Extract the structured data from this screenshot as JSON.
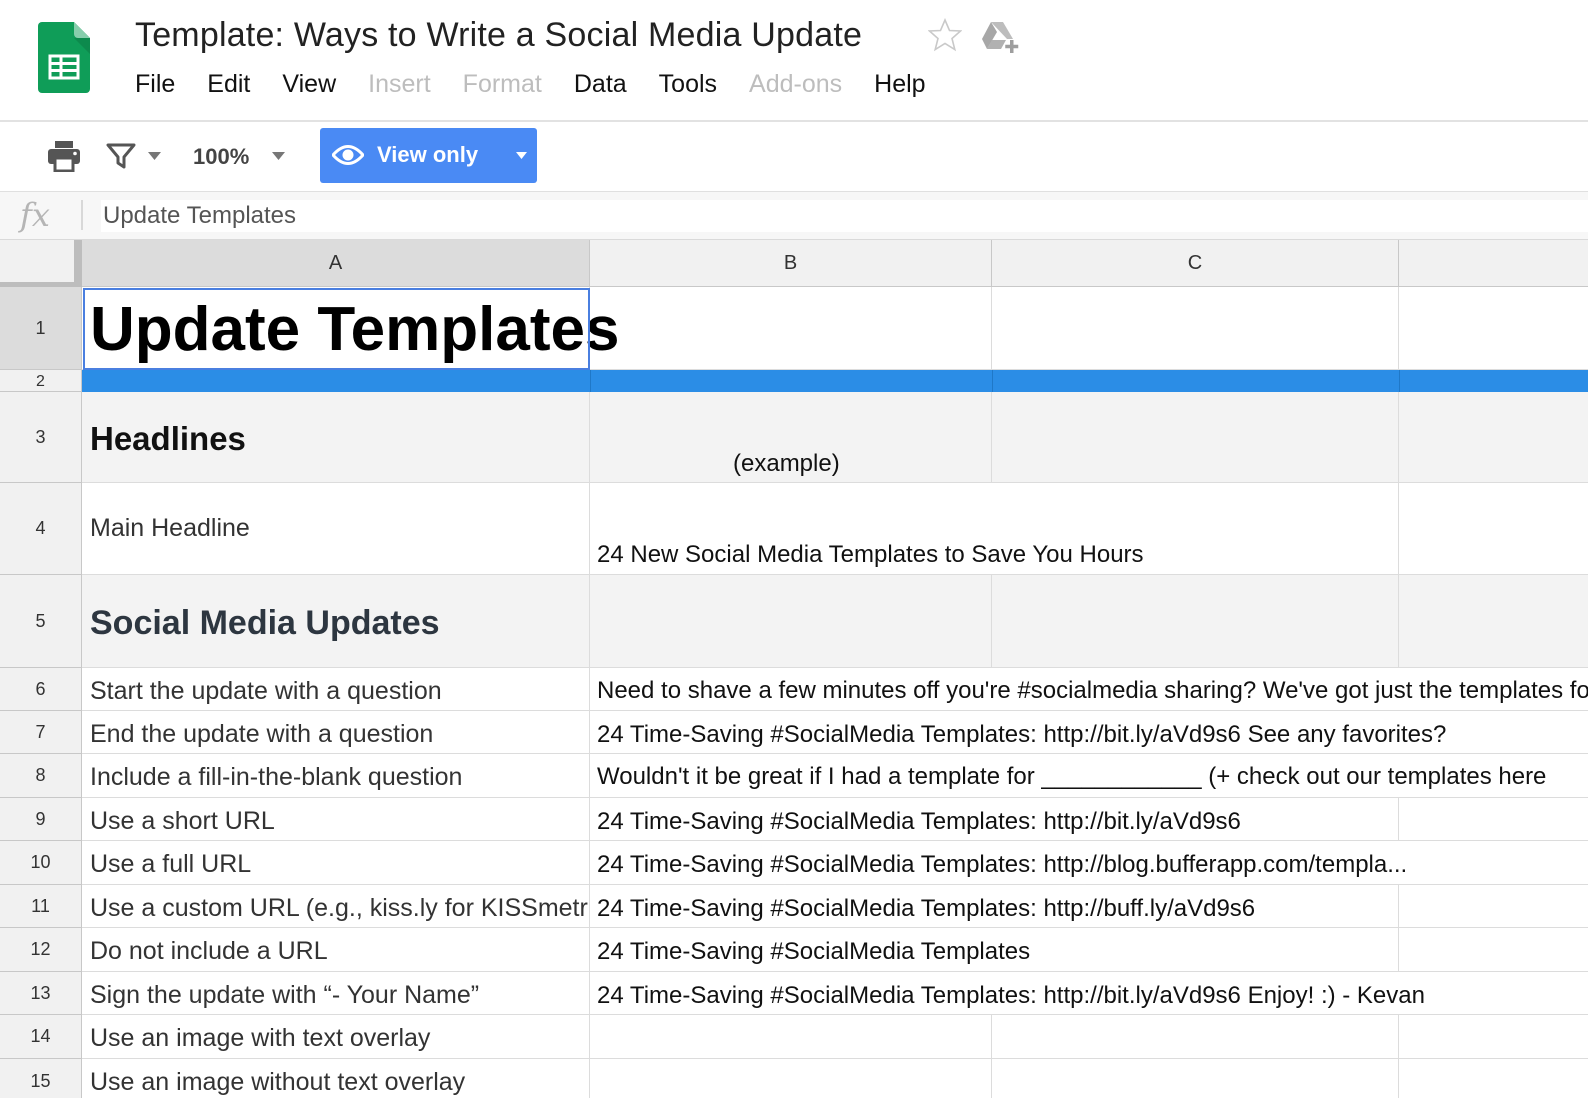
{
  "doc": {
    "title": "Template: Ways to Write a Social Media Update",
    "icons": {
      "logo": "google-sheets-logo-icon",
      "star": "star-icon",
      "drive": "add-to-drive-icon"
    }
  },
  "menu": [
    {
      "label": "File",
      "enabled": true
    },
    {
      "label": "Edit",
      "enabled": true
    },
    {
      "label": "View",
      "enabled": true
    },
    {
      "label": "Insert",
      "enabled": false
    },
    {
      "label": "Format",
      "enabled": false
    },
    {
      "label": "Data",
      "enabled": true
    },
    {
      "label": "Tools",
      "enabled": true
    },
    {
      "label": "Add-ons",
      "enabled": false
    },
    {
      "label": "Help",
      "enabled": true
    }
  ],
  "toolbar": {
    "zoom": "100%",
    "view_only_label": "View only",
    "icons": [
      "print-icon",
      "filter-icon",
      "eye-icon",
      "dropdown-arrow-icon"
    ]
  },
  "formula_bar": {
    "fx_label": "fx",
    "value": "Update Templates"
  },
  "columns": [
    "A",
    "B",
    "C"
  ],
  "rows": {
    "r1": {
      "num": "1",
      "a": "Update Templates"
    },
    "r2": {
      "num": "2"
    },
    "r3": {
      "num": "3",
      "a": "Headlines",
      "b": "(example)"
    },
    "r4": {
      "num": "4",
      "a": "Main Headline",
      "b": "24 New Social Media Templates to Save You Hours"
    },
    "r5": {
      "num": "5",
      "a": "Social Media Updates"
    },
    "r6": {
      "num": "6",
      "a": "Start the update with a question",
      "b": "Need to shave a few minutes off you're #socialmedia sharing? We've got just the templates for you"
    },
    "r7": {
      "num": "7",
      "a": "End the update with a question",
      "b": "24 Time-Saving #SocialMedia Templates: http://bit.ly/aVd9s6 See any favorites?"
    },
    "r8": {
      "num": "8",
      "a": "Include a fill-in-the-blank question",
      "b": "Wouldn't it be great if I had a template for ____________ (+ check out our templates here"
    },
    "r9": {
      "num": "9",
      "a": "Use a short URL",
      "b": "24 Time-Saving #SocialMedia Templates: http://bit.ly/aVd9s6"
    },
    "r10": {
      "num": "10",
      "a": "Use a full URL",
      "b": "24 Time-Saving #SocialMedia Templates: http://blog.bufferapp.com/templa..."
    },
    "r11": {
      "num": "11",
      "a": "Use a custom URL (e.g., kiss.ly for KISSmetrics)",
      "b": "24 Time-Saving #SocialMedia Templates: http://buff.ly/aVd9s6"
    },
    "r12": {
      "num": "12",
      "a": "Do not include a URL",
      "b": "24 Time-Saving #SocialMedia Templates"
    },
    "r13": {
      "num": "13",
      "a": "Sign the update with “- Your Name”",
      "b": "24 Time-Saving #SocialMedia Templates: http://bit.ly/aVd9s6 Enjoy! :) - Kevan"
    },
    "r14": {
      "num": "14",
      "a": "Use an image with text overlay"
    },
    "r15": {
      "num": "15",
      "a": "Use an image without text overlay"
    }
  },
  "colors": {
    "accent": "#4a8af4",
    "band": "#2b8de6",
    "sheets_green": "#0f9d58",
    "selection": "#4a7fe0"
  }
}
